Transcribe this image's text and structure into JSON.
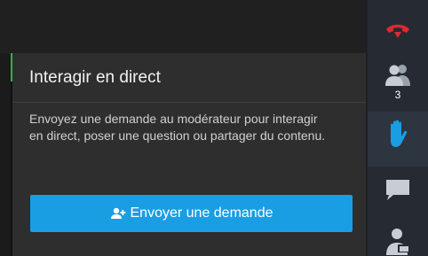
{
  "panel": {
    "title": "Interagir en direct",
    "description": "Envoyez une demande au modérateur pour interagir en direct, poser une question ou partager du contenu.",
    "button_label": "Envoyer une demande"
  },
  "sidebar": {
    "participants_count": "3",
    "icons": [
      "hangup-icon",
      "participants-icon",
      "raise-hand-icon",
      "chat-icon",
      "share-user-icon"
    ]
  },
  "colors": {
    "hangup": "#e0282e",
    "hand": "#1a9ee3",
    "button": "#1a9ee3",
    "sidebar_icon": "#c8cdd3"
  }
}
